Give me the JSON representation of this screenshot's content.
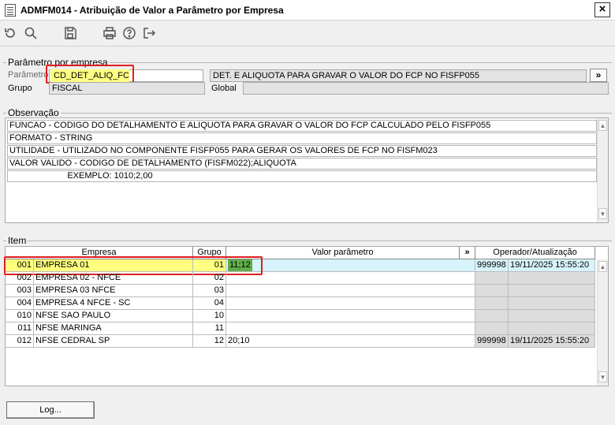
{
  "window": {
    "title": "ADMFM014 - Atribuição de Valor a Parâmetro por Empresa",
    "close_glyph": "×"
  },
  "toolbar": {
    "icons": [
      "undo-icon",
      "search-icon",
      "save-icon",
      "print-icon",
      "help-icon",
      "exit-icon"
    ]
  },
  "parametro_group": {
    "title": "Parâmetro por empresa",
    "parametro_label": "Parâmetro",
    "parametro_value": "CD_DET_ALIQ_FCP",
    "descricao_value": "DET. E ALIQUOTA PARA GRAVAR O VALOR DO FCP NO FISFP055",
    "more_label": "»",
    "grupo_label": "Grupo",
    "grupo_value": "FISCAL",
    "global_label": "Global",
    "global_value": ""
  },
  "observacao": {
    "title": "Observação",
    "lines": [
      "FUNCAO - CODIGO DO DETALHAMENTO E ALIQUOTA PARA GRAVAR O VALOR DO FCP CALCULADO PELO FISFP055",
      "FORMATO - STRING",
      "UTILIDADE - UTILIZADO NO COMPONENTE FISFP055 PARA GERAR OS VALORES DE FCP NO FISFM023",
      "VALOR VALIDO - CODIGO DE DETALHAMENTO (FISFM022);ALIQUOTA",
      "                        EXEMPLO: 1010;2,00"
    ]
  },
  "item": {
    "title": "Item",
    "columns": {
      "empresa": "Empresa",
      "grupo": "Grupo",
      "valor": "Valor parâmetro",
      "more": "»",
      "operador": "Operador/Atualização"
    },
    "rows": [
      {
        "code": "001",
        "empresa": "EMPRESA 01",
        "grupo": "01",
        "valor": "11;12",
        "operador": "999998",
        "data": "19/11/2025 15:55:20"
      },
      {
        "code": "002",
        "empresa": "EMPRESA 02 - NFCE",
        "grupo": "02",
        "valor": "",
        "operador": "",
        "data": ""
      },
      {
        "code": "003",
        "empresa": "EMPRESA 03 NFCE",
        "grupo": "03",
        "valor": "",
        "operador": "",
        "data": ""
      },
      {
        "code": "004",
        "empresa": "EMPRESA 4 NFCE - SC",
        "grupo": "04",
        "valor": "",
        "operador": "",
        "data": ""
      },
      {
        "code": "010",
        "empresa": "NFSE SAO PAULO",
        "grupo": "10",
        "valor": "",
        "operador": "",
        "data": ""
      },
      {
        "code": "011",
        "empresa": "NFSE MARINGA",
        "grupo": "11",
        "valor": "",
        "operador": "",
        "data": ""
      },
      {
        "code": "012",
        "empresa": "NFSE CEDRAL SP",
        "grupo": "12",
        "valor": "20;10",
        "operador": "999998",
        "data": "19/11/2025 15:55:20"
      }
    ]
  },
  "footer": {
    "log_label": "Log..."
  }
}
